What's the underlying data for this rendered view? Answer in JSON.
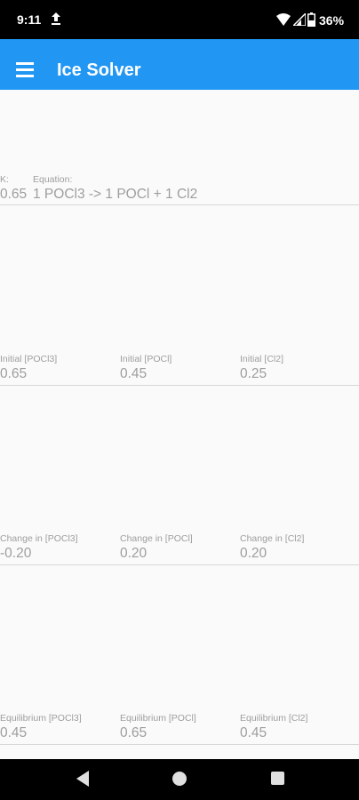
{
  "status_bar": {
    "time": "9:11",
    "battery": "36%"
  },
  "app_bar": {
    "title": "Ice Solver",
    "color": "#2196f3"
  },
  "equation_row": {
    "k_label": "K:",
    "k_value": "0.65",
    "equation_label": "Equation:",
    "equation_value": "1 POCl3 -> 1 POCl + 1 Cl2"
  },
  "initial_row": {
    "labels": [
      "Initial [POCl3]",
      "Initial [POCl]",
      "Initial [Cl2]"
    ],
    "values": [
      "0.65",
      "0.45",
      "0.25"
    ]
  },
  "change_row": {
    "labels": [
      "Change in [POCl3]",
      "Change in [POCl]",
      "Change in [Cl2]"
    ],
    "values": [
      "-0.20",
      "0.20",
      "0.20"
    ]
  },
  "equilibrium_row": {
    "labels": [
      "Equilibrium [POCl3]",
      "Equilibrium [POCl]",
      "Equilibrium [Cl2]"
    ],
    "values": [
      "0.45",
      "0.65",
      "0.45"
    ]
  }
}
